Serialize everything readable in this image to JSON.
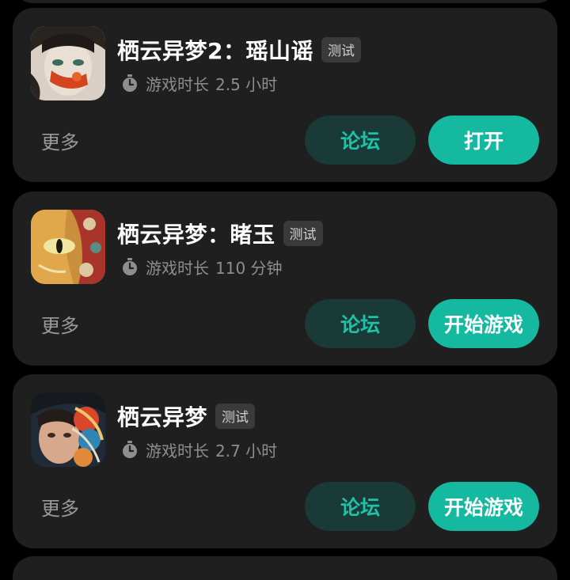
{
  "colors": {
    "background": "#000000",
    "card": "#1f1f1f",
    "accent": "#14b9a0",
    "forum_button_bg": "#1a3a37",
    "forum_button_text": "#1cc3a8",
    "badge_bg": "#3a3a3a",
    "muted_text": "#8e8e8e"
  },
  "games": [
    {
      "title": "栖云异梦2：瑶山谣",
      "badge": "测试",
      "playtime_label": "游戏时长",
      "playtime_value": "2.5 小时",
      "more_label": "更多",
      "forum_label": "论坛",
      "primary_label": "打开",
      "icon": "game-cover-icon"
    },
    {
      "title": "栖云异梦：睹玉",
      "badge": "测试",
      "playtime_label": "游戏时长",
      "playtime_value": "110 分钟",
      "more_label": "更多",
      "forum_label": "论坛",
      "primary_label": "开始游戏",
      "icon": "game-cover-icon"
    },
    {
      "title": "栖云异梦",
      "badge": "测试",
      "playtime_label": "游戏时长",
      "playtime_value": "2.7 小时",
      "more_label": "更多",
      "forum_label": "论坛",
      "primary_label": "开始游戏",
      "icon": "game-cover-icon"
    }
  ]
}
